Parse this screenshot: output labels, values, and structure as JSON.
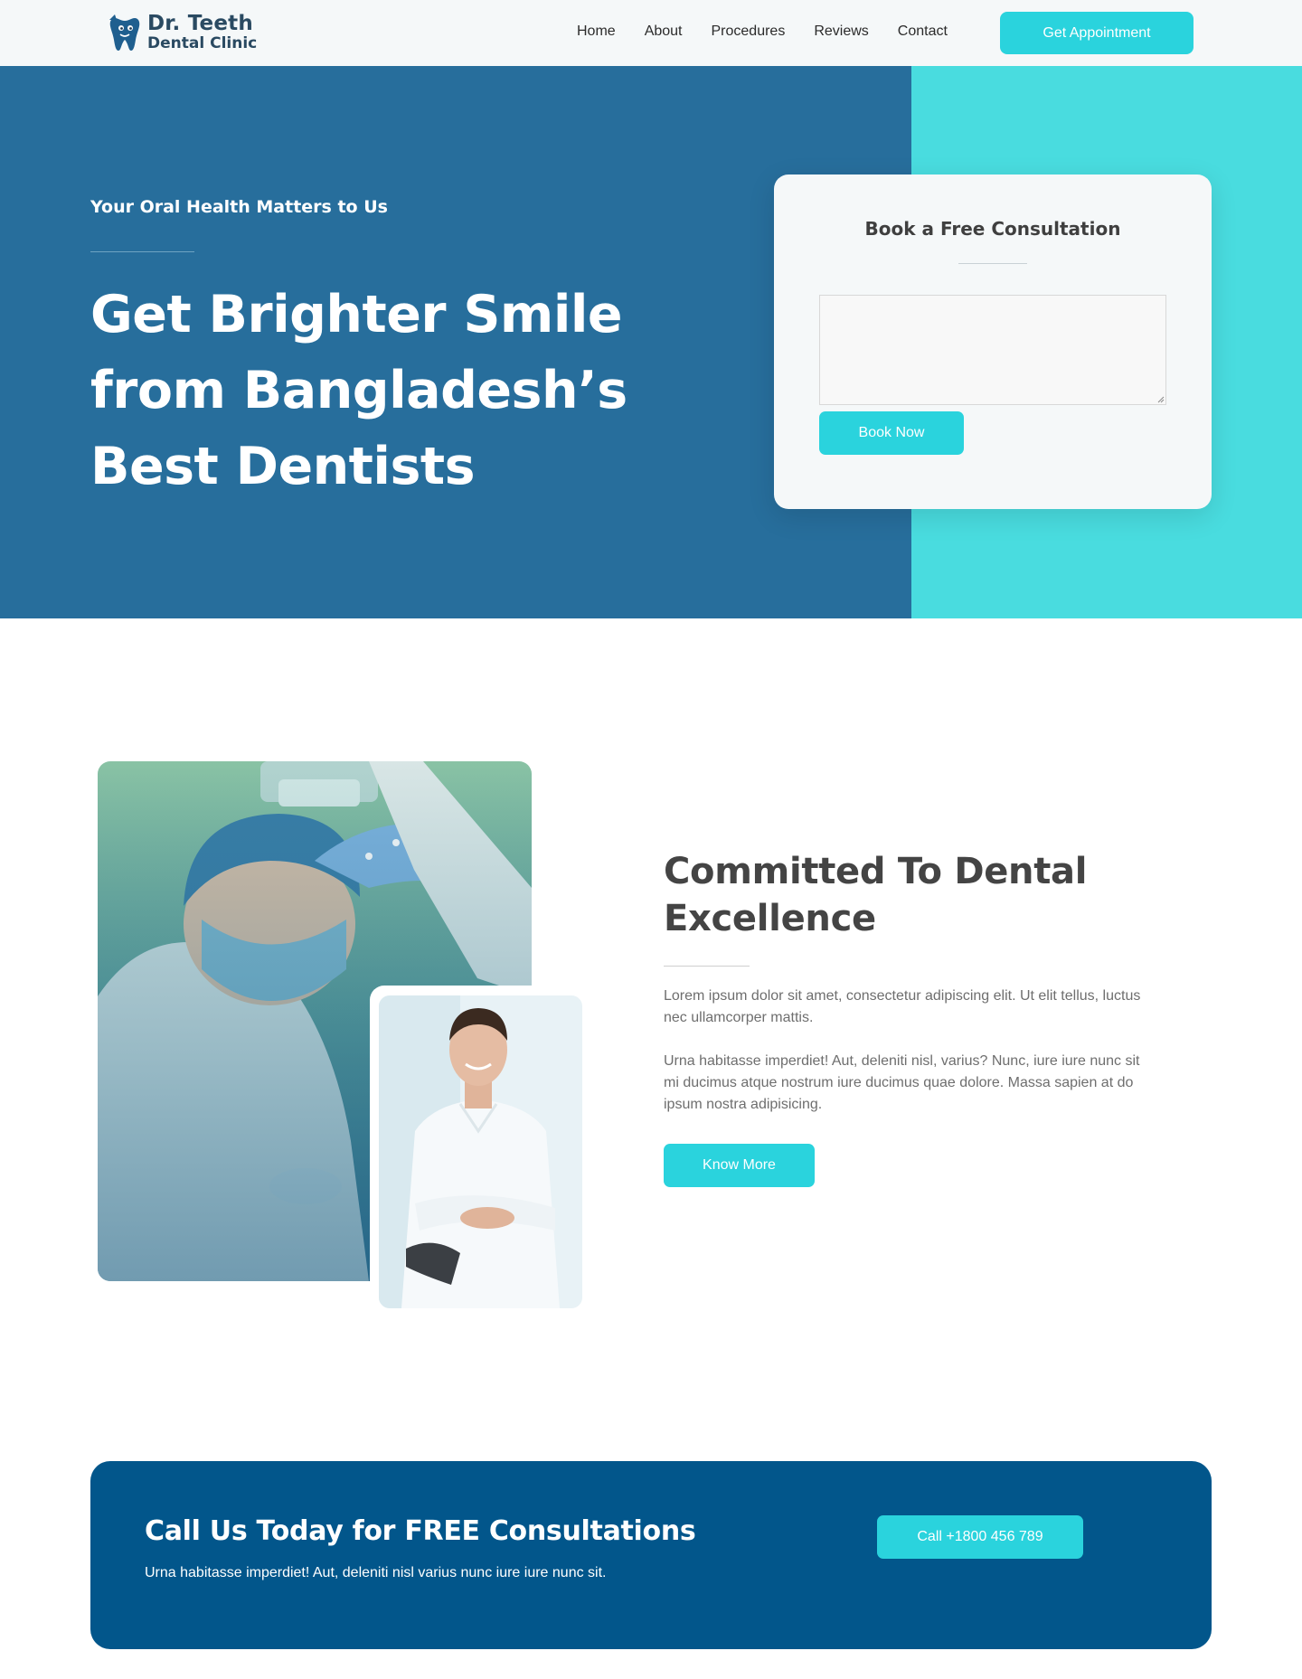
{
  "header": {
    "logo_name": "Dr. Teeth",
    "logo_sub": "Dental Clinic",
    "logo_icon": "tooth-icon",
    "nav": [
      "Home",
      "About",
      "Procedures",
      "Reviews",
      "Contact"
    ],
    "appointment_label": "Get Appointment"
  },
  "hero": {
    "eyebrow": "Your Oral Health Matters to Us",
    "title": "Get Brighter Smile from Bangladesh’s Best Dentists"
  },
  "consultation": {
    "title": "Book a Free Consultation",
    "textarea_value": "",
    "button_label": "Book Now"
  },
  "about": {
    "title": "Committed To Dental Excellence",
    "paragraph_1": "Lorem ipsum dolor sit amet, consectetur adipiscing elit. Ut elit tellus, luctus nec ullamcorper mattis.",
    "paragraph_2": "Urna habitasse imperdiet! Aut, deleniti nisl, varius? Nunc, iure iure nunc sit mi ducimus atque nostrum iure ducimus quae dolore. Massa sapien at do ipsum nostra adipisicing.",
    "button_label": "Know More",
    "image_main": "surgeons-photo",
    "image_secondary": "dentist-portrait-photo"
  },
  "cta": {
    "title": "Call Us Today for FREE Consultations",
    "subtitle": "Urna habitasse imperdiet! Aut, deleniti nisl varius nunc iure iure nunc sit.",
    "button_label": "Call +1800 456 789"
  },
  "colors": {
    "hero_blue": "#276e9c",
    "accent_cyan": "#2ad3dd",
    "hero_cyan": "#49dcdf",
    "cta_blue": "#02568b",
    "heading_dark": "#444444"
  }
}
